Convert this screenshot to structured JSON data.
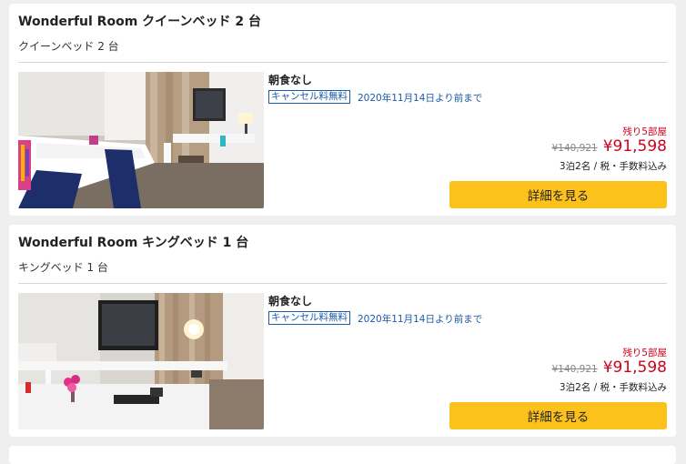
{
  "rooms": [
    {
      "title": "Wonderful Room クイーンベッド 2 台",
      "subtitle": "クイーンベッド 2 台",
      "photo_icon": "room-photo-queen",
      "meal": "朝食なし",
      "cancel_badge": "キャンセル料無料",
      "cancel_deadline": "2020年11月14日より前まで",
      "rooms_left": "残り5部屋",
      "old_price": "¥140,921",
      "price": "¥91,598",
      "price_note": "3泊2名 / 税・手数料込み",
      "button_label": "詳細を見る"
    },
    {
      "title": "Wonderful Room キングベッド 1 台",
      "subtitle": "キングベッド 1 台",
      "photo_icon": "room-photo-king",
      "meal": "朝食なし",
      "cancel_badge": "キャンセル料無料",
      "cancel_deadline": "2020年11月14日より前まで",
      "rooms_left": "残り5部屋",
      "old_price": "¥140,921",
      "price": "¥91,598",
      "price_note": "3泊2名 / 税・手数料込み",
      "button_label": "詳細を見る"
    }
  ],
  "colors": {
    "accent_button": "#fcc21b",
    "price_red": "#d0021b",
    "link_blue": "#1a5aa8",
    "page_bg": "#efefef"
  }
}
